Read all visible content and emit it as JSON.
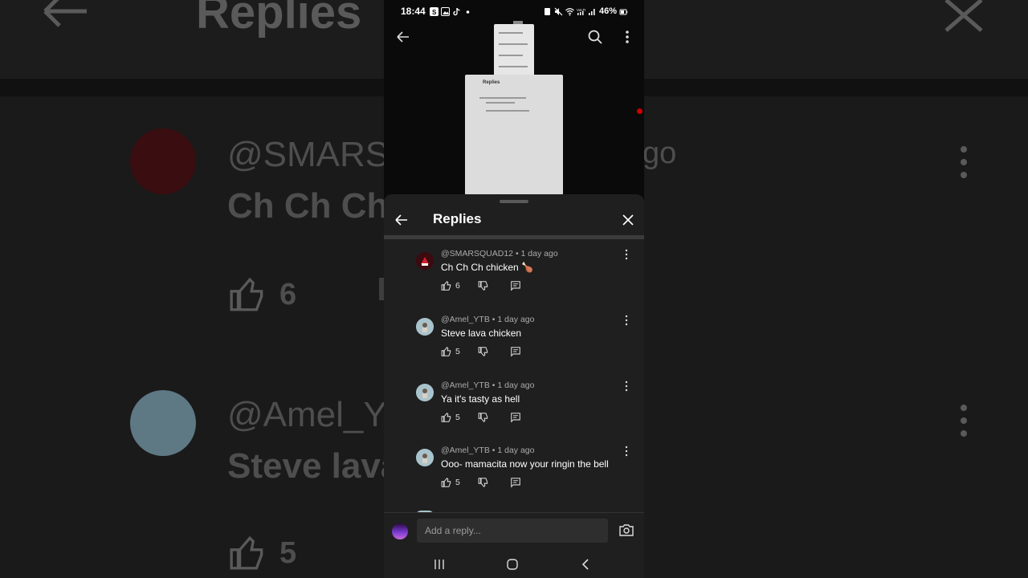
{
  "background": {
    "title": "Replies",
    "handle1": "@SMARSQ",
    "text1": "Ch Ch Ch",
    "ago": "go",
    "count1": "6",
    "handle2": "@Amel_YT",
    "text2": "Steve lava",
    "count2": "5"
  },
  "statusbar": {
    "time": "18:44",
    "battery": "46%",
    "icons": [
      "s-app-icon",
      "gallery-icon",
      "tiktok-icon",
      "dot-icon",
      "wifi-icon",
      "volte-icon",
      "signal-icon",
      "battery-icon"
    ]
  },
  "thumbnail": {
    "title": "Replies"
  },
  "sheet": {
    "title": "Replies",
    "comments": [
      {
        "handle": "@SMARSQUAD12",
        "time": "• 1 day ago",
        "text": "Ch Ch Ch chicken 🍗",
        "likes": "6"
      },
      {
        "handle": "@Amel_YTB",
        "time": "• 1 day ago",
        "text": "Steve lava chicken",
        "likes": "5"
      },
      {
        "handle": "@Amel_YTB",
        "time": "• 1 day ago",
        "text": "Ya it's tasty as hell",
        "likes": "5"
      },
      {
        "handle": "@Amel_YTB",
        "time": "• 1 day ago",
        "text": "Ooo- mamacita now your ringin the bell",
        "likes": "5"
      }
    ]
  },
  "composer": {
    "placeholder": "Add a reply..."
  },
  "colors": {
    "sheet_bg": "#1f1f1f",
    "accent_red": "#c00000"
  }
}
